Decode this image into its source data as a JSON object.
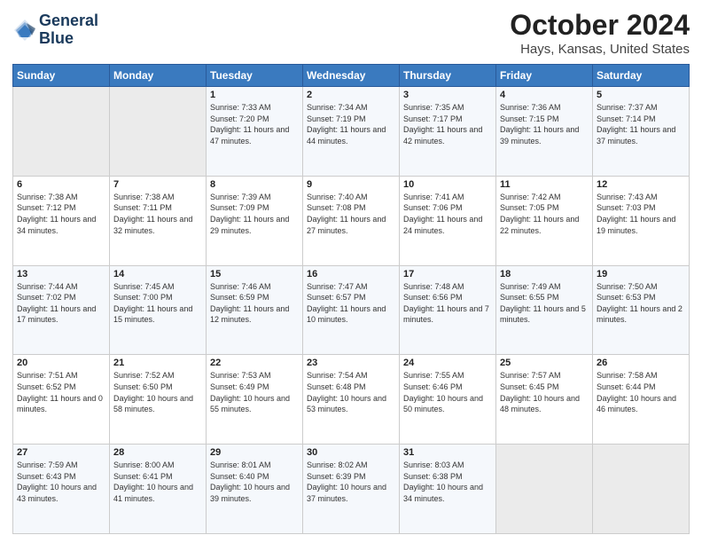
{
  "header": {
    "logo_line1": "General",
    "logo_line2": "Blue",
    "title": "October 2024",
    "subtitle": "Hays, Kansas, United States"
  },
  "weekdays": [
    "Sunday",
    "Monday",
    "Tuesday",
    "Wednesday",
    "Thursday",
    "Friday",
    "Saturday"
  ],
  "weeks": [
    [
      {
        "day": "",
        "info": ""
      },
      {
        "day": "",
        "info": ""
      },
      {
        "day": "1",
        "info": "Sunrise: 7:33 AM\nSunset: 7:20 PM\nDaylight: 11 hours and 47 minutes."
      },
      {
        "day": "2",
        "info": "Sunrise: 7:34 AM\nSunset: 7:19 PM\nDaylight: 11 hours and 44 minutes."
      },
      {
        "day": "3",
        "info": "Sunrise: 7:35 AM\nSunset: 7:17 PM\nDaylight: 11 hours and 42 minutes."
      },
      {
        "day": "4",
        "info": "Sunrise: 7:36 AM\nSunset: 7:15 PM\nDaylight: 11 hours and 39 minutes."
      },
      {
        "day": "5",
        "info": "Sunrise: 7:37 AM\nSunset: 7:14 PM\nDaylight: 11 hours and 37 minutes."
      }
    ],
    [
      {
        "day": "6",
        "info": "Sunrise: 7:38 AM\nSunset: 7:12 PM\nDaylight: 11 hours and 34 minutes."
      },
      {
        "day": "7",
        "info": "Sunrise: 7:38 AM\nSunset: 7:11 PM\nDaylight: 11 hours and 32 minutes."
      },
      {
        "day": "8",
        "info": "Sunrise: 7:39 AM\nSunset: 7:09 PM\nDaylight: 11 hours and 29 minutes."
      },
      {
        "day": "9",
        "info": "Sunrise: 7:40 AM\nSunset: 7:08 PM\nDaylight: 11 hours and 27 minutes."
      },
      {
        "day": "10",
        "info": "Sunrise: 7:41 AM\nSunset: 7:06 PM\nDaylight: 11 hours and 24 minutes."
      },
      {
        "day": "11",
        "info": "Sunrise: 7:42 AM\nSunset: 7:05 PM\nDaylight: 11 hours and 22 minutes."
      },
      {
        "day": "12",
        "info": "Sunrise: 7:43 AM\nSunset: 7:03 PM\nDaylight: 11 hours and 19 minutes."
      }
    ],
    [
      {
        "day": "13",
        "info": "Sunrise: 7:44 AM\nSunset: 7:02 PM\nDaylight: 11 hours and 17 minutes."
      },
      {
        "day": "14",
        "info": "Sunrise: 7:45 AM\nSunset: 7:00 PM\nDaylight: 11 hours and 15 minutes."
      },
      {
        "day": "15",
        "info": "Sunrise: 7:46 AM\nSunset: 6:59 PM\nDaylight: 11 hours and 12 minutes."
      },
      {
        "day": "16",
        "info": "Sunrise: 7:47 AM\nSunset: 6:57 PM\nDaylight: 11 hours and 10 minutes."
      },
      {
        "day": "17",
        "info": "Sunrise: 7:48 AM\nSunset: 6:56 PM\nDaylight: 11 hours and 7 minutes."
      },
      {
        "day": "18",
        "info": "Sunrise: 7:49 AM\nSunset: 6:55 PM\nDaylight: 11 hours and 5 minutes."
      },
      {
        "day": "19",
        "info": "Sunrise: 7:50 AM\nSunset: 6:53 PM\nDaylight: 11 hours and 2 minutes."
      }
    ],
    [
      {
        "day": "20",
        "info": "Sunrise: 7:51 AM\nSunset: 6:52 PM\nDaylight: 11 hours and 0 minutes."
      },
      {
        "day": "21",
        "info": "Sunrise: 7:52 AM\nSunset: 6:50 PM\nDaylight: 10 hours and 58 minutes."
      },
      {
        "day": "22",
        "info": "Sunrise: 7:53 AM\nSunset: 6:49 PM\nDaylight: 10 hours and 55 minutes."
      },
      {
        "day": "23",
        "info": "Sunrise: 7:54 AM\nSunset: 6:48 PM\nDaylight: 10 hours and 53 minutes."
      },
      {
        "day": "24",
        "info": "Sunrise: 7:55 AM\nSunset: 6:46 PM\nDaylight: 10 hours and 50 minutes."
      },
      {
        "day": "25",
        "info": "Sunrise: 7:57 AM\nSunset: 6:45 PM\nDaylight: 10 hours and 48 minutes."
      },
      {
        "day": "26",
        "info": "Sunrise: 7:58 AM\nSunset: 6:44 PM\nDaylight: 10 hours and 46 minutes."
      }
    ],
    [
      {
        "day": "27",
        "info": "Sunrise: 7:59 AM\nSunset: 6:43 PM\nDaylight: 10 hours and 43 minutes."
      },
      {
        "day": "28",
        "info": "Sunrise: 8:00 AM\nSunset: 6:41 PM\nDaylight: 10 hours and 41 minutes."
      },
      {
        "day": "29",
        "info": "Sunrise: 8:01 AM\nSunset: 6:40 PM\nDaylight: 10 hours and 39 minutes."
      },
      {
        "day": "30",
        "info": "Sunrise: 8:02 AM\nSunset: 6:39 PM\nDaylight: 10 hours and 37 minutes."
      },
      {
        "day": "31",
        "info": "Sunrise: 8:03 AM\nSunset: 6:38 PM\nDaylight: 10 hours and 34 minutes."
      },
      {
        "day": "",
        "info": ""
      },
      {
        "day": "",
        "info": ""
      }
    ]
  ]
}
